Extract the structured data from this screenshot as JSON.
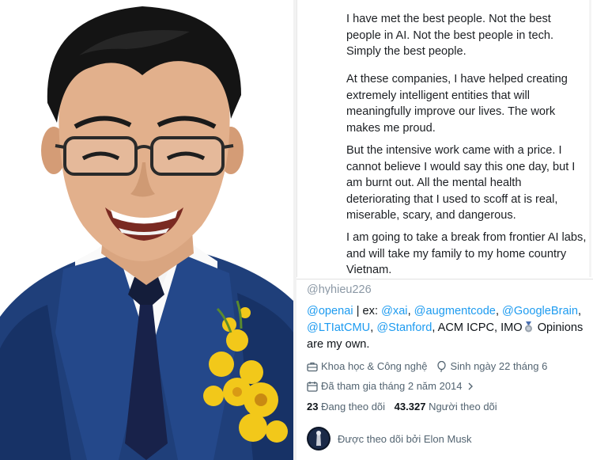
{
  "tweet": {
    "paragraphs": [
      "I have met the best people. Not the best people in AI. Not the best people in tech. Simply the best people.",
      "At these companies, I have helped creating extremely intelligent entities that will meaningfully improve our lives. The work makes me proud.",
      "But the intensive work came with a price. I cannot believe I would say this one day, but I am burnt out. All the mental health deteriorating that I used to scoff at is real, miserable, scary, and dangerous.",
      "I am going to take a break from frontier AI labs, and will take my family to my home country Vietnam."
    ]
  },
  "profile": {
    "handle": "@hyhieu226",
    "bio": {
      "openai": "@openai",
      "ex_text": " | ex: ",
      "xai": "@xai",
      "comma1": ", ",
      "augmentcode": "@augmentcode",
      "comma2": ", ",
      "googlebrain": "@GoogleBrain",
      "comma3": ",",
      "ltiatcmu": "@LTIatCMU",
      "comma4": ", ",
      "stanford": "@Stanford",
      "tail1": ", ACM ICPC, IMO",
      "tail2": " Opinions are my own."
    },
    "category": "Khoa học & Công nghệ",
    "birthday": "Sinh ngày 22 tháng 6",
    "joined": "Đã tham gia tháng 2 năm 2014",
    "following_count": "23",
    "following_label": "Đang theo dõi",
    "followers_count": "43.327",
    "followers_label": "Người theo dõi",
    "followed_by": "Được theo dõi bởi Elon Musk"
  },
  "colors": {
    "link": "#1d9bf0",
    "text": "#0f1419",
    "muted": "#536471",
    "suit": "#1f3f7a",
    "flower": "#f2c81a"
  },
  "icons": [
    "briefcase-icon",
    "balloon-icon",
    "calendar-icon",
    "chevron-right-icon",
    "medal-icon"
  ]
}
